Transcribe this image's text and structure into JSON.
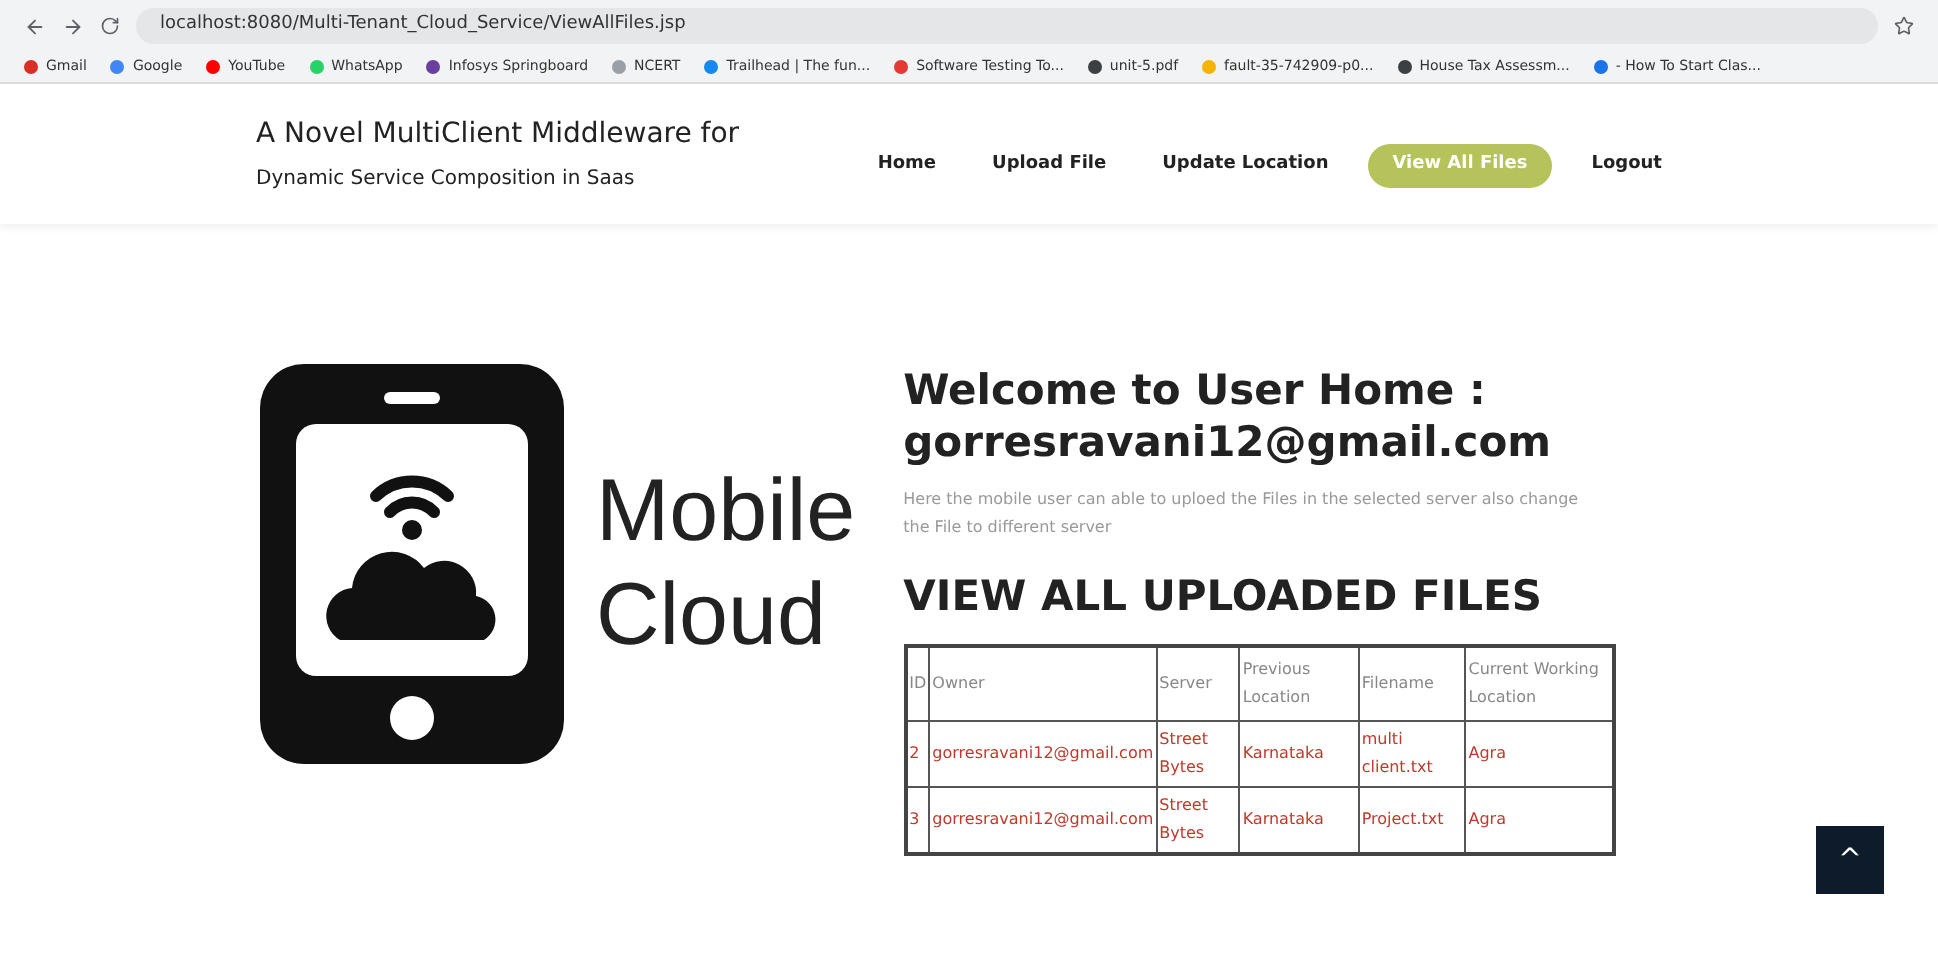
{
  "browser": {
    "url": "localhost:8080/Multi-Tenant_Cloud_Service/ViewAllFiles.jsp",
    "bookmarks": [
      {
        "label": "Gmail",
        "color": "#d93025"
      },
      {
        "label": "Google",
        "color": "#4285f4"
      },
      {
        "label": "YouTube",
        "color": "#ff0000"
      },
      {
        "label": "WhatsApp",
        "color": "#25d366"
      },
      {
        "label": "Infosys Springboard",
        "color": "#6a3fa0"
      },
      {
        "label": "NCERT",
        "color": "#9aa0a6"
      },
      {
        "label": "Trailhead | The fun...",
        "color": "#1589ee"
      },
      {
        "label": "Software Testing To...",
        "color": "#e53935"
      },
      {
        "label": "unit-5.pdf",
        "color": "#3c4043"
      },
      {
        "label": "fault-35-742909-p0...",
        "color": "#f4b400"
      },
      {
        "label": "House Tax Assessm...",
        "color": "#3c4043"
      },
      {
        "label": "- How To Start Clas...",
        "color": "#1a73e8"
      }
    ]
  },
  "site": {
    "title_line1": "A Novel MultiClient Middleware for",
    "title_line2": "Dynamic Service Composition in Saas",
    "nav": [
      {
        "label": "Home",
        "selected": false
      },
      {
        "label": "Upload File",
        "selected": false
      },
      {
        "label": "Update Location",
        "selected": false
      },
      {
        "label": "View All Files",
        "selected": true
      },
      {
        "label": "Logout",
        "selected": false
      }
    ]
  },
  "logo": {
    "line1": "Mobile",
    "line2": "Cloud"
  },
  "welcome": {
    "heading_line1": "Welcome to User Home :",
    "heading_line2": "gorresravani12@gmail.com",
    "description": "Here the mobile user can able to uploed the Files in the selected server also change the File to different server"
  },
  "table": {
    "title": "VIEW ALL UPLOADED FILES",
    "columns": [
      "ID",
      "Owner",
      "Server",
      "Previous Location",
      "Filename",
      "Current Working Location"
    ],
    "rows": [
      [
        "2",
        "gorresravani12@gmail.com",
        "Street Bytes",
        "Karnataka",
        "multi client.txt",
        "Agra"
      ],
      [
        "3",
        "gorresravani12@gmail.com",
        "Street Bytes",
        "Karnataka",
        "Project.txt",
        "Agra"
      ]
    ]
  },
  "scroll_top": {
    "label": "^"
  }
}
